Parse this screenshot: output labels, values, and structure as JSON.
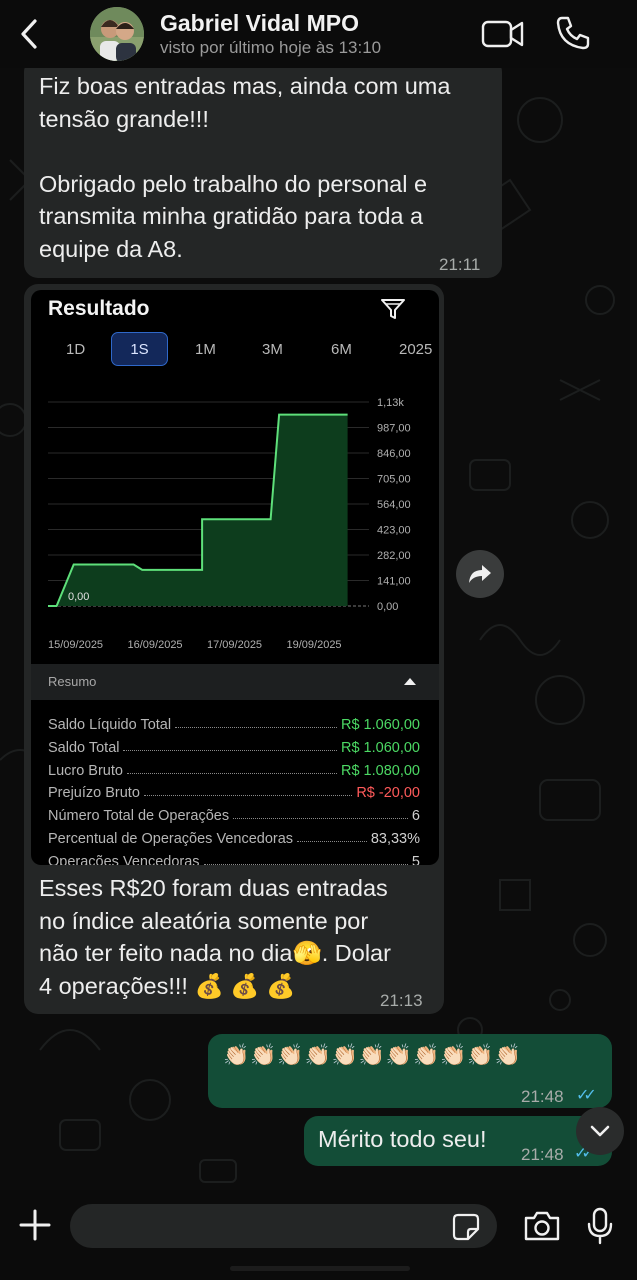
{
  "header": {
    "contact_name": "Gabriel Vidal MPO",
    "status": "visto por último hoje às 13:10"
  },
  "messages": [
    {
      "id": "m1",
      "direction": "incoming",
      "text": "Fiz boas entradas mas, ainda com uma\ntensão grande!!!\n\nObrigado pelo trabalho do personal e\ntransmita minha gratidão para toda a\nequipe da A8.",
      "time": "21:11"
    },
    {
      "id": "m2",
      "direction": "incoming",
      "type": "image-with-caption",
      "caption": "Esses R$20 foram duas entradas\nno índice aleatória somente por\nnão ter feito nada no dia🫣. Dolar\n4 operações!!! 💰 💰 💰",
      "time": "21:13"
    },
    {
      "id": "m3",
      "direction": "outgoing",
      "text": "👏🏻👏🏻👏🏻👏🏻👏🏻👏🏻👏🏻👏🏻👏🏻👏🏻👏🏻",
      "time": "21:48",
      "status": "read"
    },
    {
      "id": "m4",
      "direction": "outgoing",
      "text": "Mérito todo seu!",
      "time": "21:48",
      "status": "read"
    }
  ],
  "result_card": {
    "title": "Resultado",
    "periods": [
      "1D",
      "1S",
      "1M",
      "3M",
      "6M",
      "2025"
    ],
    "active_period": "1S",
    "summary_label": "Resumo",
    "summary_rows": [
      {
        "label": "Saldo Líquido Total",
        "value": "R$ 1.060,00",
        "color": "#4cd964"
      },
      {
        "label": "Saldo Total",
        "value": "R$ 1.060,00",
        "color": "#4cd964"
      },
      {
        "label": "Lucro Bruto",
        "value": "R$ 1.080,00",
        "color": "#4cd964"
      },
      {
        "label": "Prejuízo Bruto",
        "value": "R$ -20,00",
        "color": "#ff5a5a"
      },
      {
        "label": "Número Total de Operações",
        "value": "6",
        "color": "#d0d0d0"
      },
      {
        "label": "Percentual de Operações Vencedoras",
        "value": "83,33%",
        "color": "#d0d0d0"
      },
      {
        "label": "Operações Vencedoras",
        "value": "5",
        "color": "#d0d0d0"
      }
    ]
  },
  "chart_data": {
    "type": "line",
    "x_tick_labels": [
      "15/09/2025",
      "16/09/2025",
      "17/09/2025",
      "19/09/2025"
    ],
    "y_tick_labels": [
      "1,13k",
      "987,00",
      "846,00",
      "705,00",
      "564,00",
      "423,00",
      "282,00",
      "141,00",
      "0,00"
    ],
    "ylim": [
      0,
      1130
    ],
    "start_label": "0,00",
    "points": [
      {
        "x": 0.0,
        "y": 0
      },
      {
        "x": 0.1,
        "y": 0
      },
      {
        "x": 0.3,
        "y": 230
      },
      {
        "x": 1.0,
        "y": 230
      },
      {
        "x": 1.1,
        "y": 200
      },
      {
        "x": 1.8,
        "y": 200
      },
      {
        "x": 1.8,
        "y": 480
      },
      {
        "x": 2.6,
        "y": 480
      },
      {
        "x": 2.7,
        "y": 1060
      },
      {
        "x": 3.5,
        "y": 1060
      }
    ],
    "line_color": "#5ee07a",
    "fill_color": "#0d3d1d"
  },
  "composer": {
    "placeholder": ""
  }
}
